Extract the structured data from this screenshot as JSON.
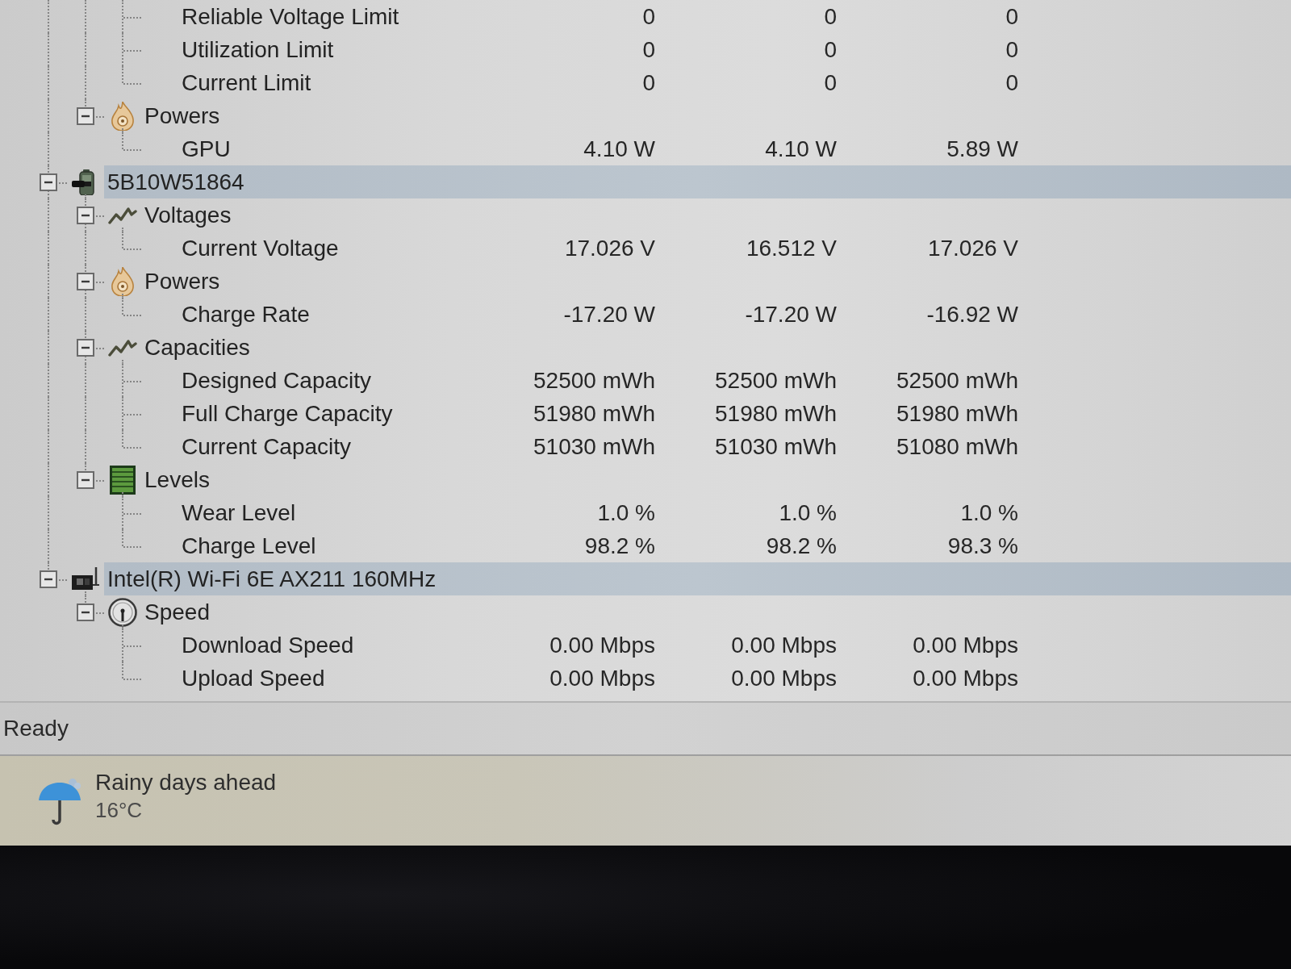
{
  "tree": [
    {
      "children": [
        {
          "children": [
            {
              "kind": "sensor",
              "label": "Reliable Voltage Limit",
              "values": [
                "0",
                "0",
                "0"
              ]
            },
            {
              "kind": "sensor",
              "label": "Utilization Limit",
              "values": [
                "0",
                "0",
                "0"
              ]
            },
            {
              "kind": "sensor",
              "label": "Current Limit",
              "values": [
                "0",
                "0",
                "0"
              ]
            }
          ]
        },
        {
          "kind": "power",
          "label": "Powers",
          "expanded": true,
          "children": [
            {
              "kind": "sensor",
              "label": "GPU",
              "values": [
                "4.10 W",
                "4.10 W",
                "5.89 W"
              ]
            }
          ]
        }
      ]
    },
    {
      "kind": "battery",
      "label": "5B10W51864",
      "expanded": true,
      "children": [
        {
          "kind": "voltage",
          "label": "Voltages",
          "expanded": true,
          "children": [
            {
              "kind": "sensor",
              "label": "Current Voltage",
              "values": [
                "17.026 V",
                "16.512 V",
                "17.026 V"
              ]
            }
          ]
        },
        {
          "kind": "power",
          "label": "Powers",
          "expanded": true,
          "children": [
            {
              "kind": "sensor",
              "label": "Charge Rate",
              "values": [
                "-17.20 W",
                "-17.20 W",
                "-16.92 W"
              ]
            }
          ]
        },
        {
          "kind": "capacity",
          "label": "Capacities",
          "expanded": true,
          "children": [
            {
              "kind": "sensor",
              "label": "Designed Capacity",
              "values": [
                "52500 mWh",
                "52500 mWh",
                "52500 mWh"
              ]
            },
            {
              "kind": "sensor",
              "label": "Full Charge Capacity",
              "values": [
                "51980 mWh",
                "51980 mWh",
                "51980 mWh"
              ]
            },
            {
              "kind": "sensor",
              "label": "Current Capacity",
              "values": [
                "51030 mWh",
                "51030 mWh",
                "51080 mWh"
              ]
            }
          ]
        },
        {
          "kind": "level",
          "label": "Levels",
          "expanded": true,
          "children": [
            {
              "kind": "sensor",
              "label": "Wear Level",
              "values": [
                "1.0 %",
                "1.0 %",
                "1.0 %"
              ]
            },
            {
              "kind": "sensor",
              "label": "Charge Level",
              "values": [
                "98.2 %",
                "98.2 %",
                "98.3 %"
              ]
            }
          ]
        }
      ]
    },
    {
      "kind": "network",
      "label": "Intel(R) Wi-Fi 6E AX211 160MHz",
      "expanded": true,
      "children": [
        {
          "kind": "speed",
          "label": "Speed",
          "expanded": true,
          "children": [
            {
              "kind": "sensor",
              "label": "Download Speed",
              "values": [
                "0.00 Mbps",
                "0.00 Mbps",
                "0.00 Mbps"
              ]
            },
            {
              "kind": "sensor",
              "label": "Upload Speed",
              "values": [
                "0.00 Mbps",
                "0.00 Mbps",
                "0.00 Mbps"
              ]
            }
          ]
        }
      ]
    }
  ],
  "status_bar": {
    "text": "Ready"
  },
  "taskbar": {
    "weather": {
      "condition": "Rainy days ahead",
      "temperature": "16°C"
    }
  }
}
